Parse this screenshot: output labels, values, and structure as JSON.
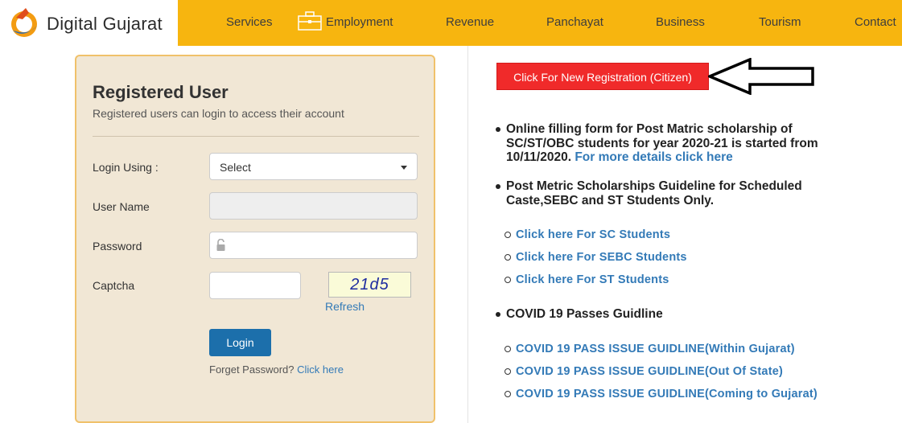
{
  "brand": {
    "name": "Digital Gujarat"
  },
  "nav": {
    "items": [
      "Services",
      "Employment",
      "Revenue",
      "Panchayat",
      "Business",
      "Tourism",
      "Contact"
    ]
  },
  "login": {
    "title": "Registered User",
    "subtitle": "Registered users can login to access their account",
    "login_using_label": "Login Using :",
    "login_using_value": "Select",
    "username_label": "User Name",
    "password_label": "Password",
    "captcha_label": "Captcha",
    "captcha_text": "21d5",
    "refresh_label": "Refresh",
    "login_button": "Login",
    "forget_text": "Forget Password?",
    "forget_link": "Click here"
  },
  "registration": {
    "button_label": "Click For New Registration (Citizen)"
  },
  "notices": {
    "item1_line1": "Online filling form for Post Matric scholarship of",
    "item1_line2": "SC/ST/OBC students for year 2020-21 is started from",
    "item1_line3": "10/11/2020.",
    "item1_link": "For more details click here",
    "item2_line1": "Post Metric Scholarships Guideline for Scheduled",
    "item2_line2": "Caste,SEBC and ST Students Only.",
    "scholarship_links": [
      "Click here For SC Students",
      "Click here For SEBC Students",
      "Click here For ST Students"
    ],
    "item3": "COVID 19 Passes Guidline",
    "covid_links": [
      "COVID 19 PASS ISSUE GUIDLINE(Within Gujarat)",
      "COVID 19 PASS ISSUE GUIDLINE(Out Of State)",
      "COVID 19 PASS ISSUE GUIDLINE(Coming to Gujarat)"
    ]
  },
  "colors": {
    "nav_bg": "#f7b50f",
    "login_bg": "#f1e7d5",
    "login_border": "#f0c16a",
    "register_btn": "#f02a2a",
    "login_btn": "#1c6fab",
    "link": "#337ab7"
  },
  "icons": {
    "logo": "digital-gujarat-logo",
    "employment": "briefcase-icon",
    "password": "lock-icon",
    "select": "chevron-down-icon",
    "arrow": "left-arrow-icon"
  }
}
